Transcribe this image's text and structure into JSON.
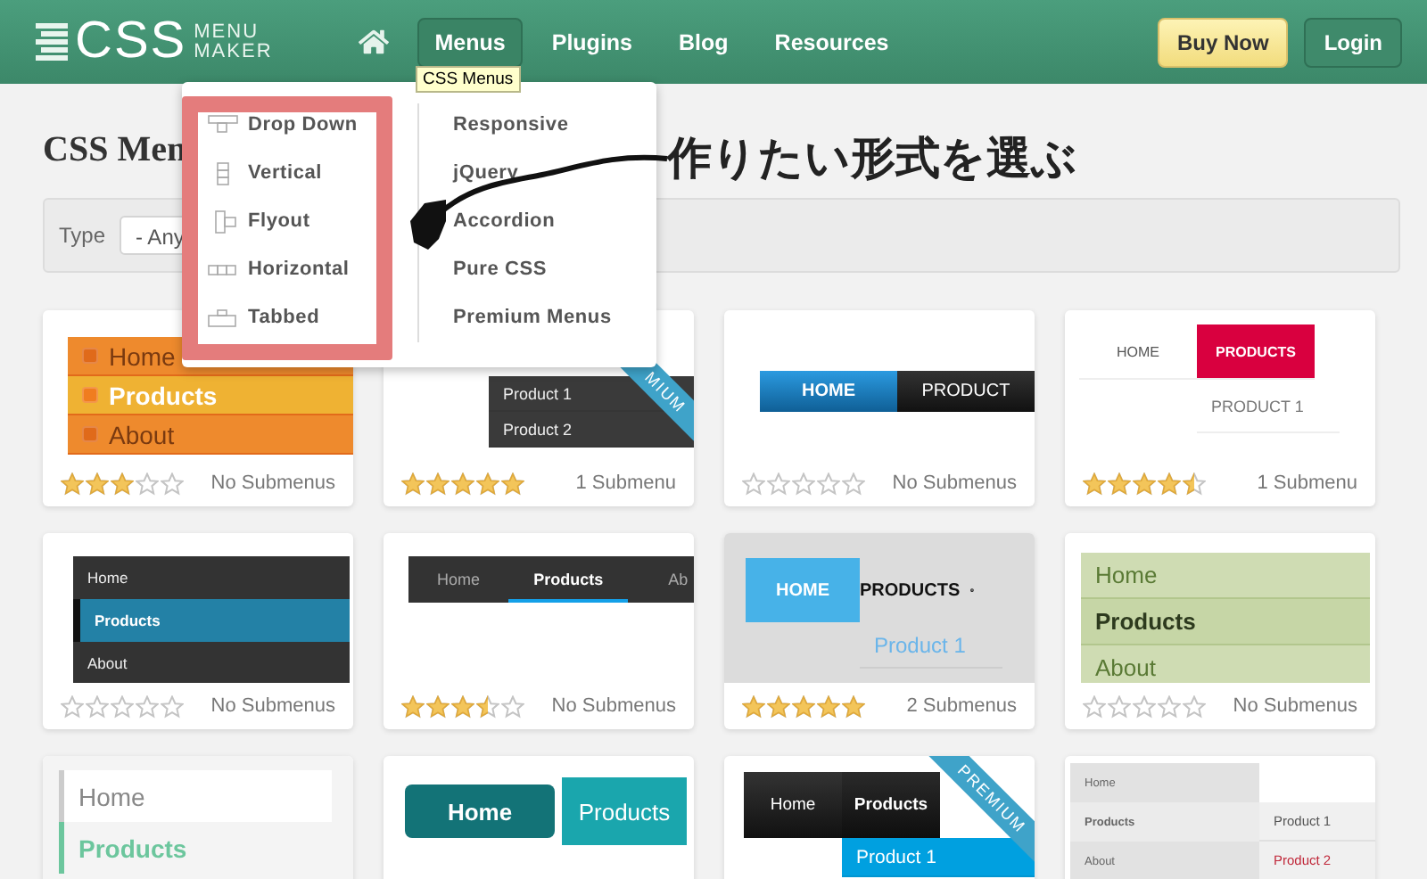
{
  "header": {
    "logo": {
      "main": "CSS",
      "top": "MENU",
      "bottom": "MAKER"
    },
    "nav": [
      {
        "label": "Menus",
        "selected": true
      },
      {
        "label": "Plugins",
        "selected": false
      },
      {
        "label": "Blog",
        "selected": false
      },
      {
        "label": "Resources",
        "selected": false
      }
    ],
    "buttons": [
      {
        "label": "Buy Now",
        "kind": "primary"
      },
      {
        "label": "Login",
        "kind": "secondary"
      }
    ]
  },
  "tooltip": "CSS Menus",
  "dropdown": {
    "types": [
      {
        "label": "Drop Down",
        "kind": "dropdown"
      },
      {
        "label": "Vertical",
        "kind": "vertical"
      },
      {
        "label": "Flyout",
        "kind": "flyout"
      },
      {
        "label": "Horizontal",
        "kind": "horizontal"
      },
      {
        "label": "Tabbed",
        "kind": "tabbed"
      }
    ],
    "features": [
      "Responsive",
      "jQuery",
      "Accordion",
      "Pure CSS",
      "Premium Menus"
    ]
  },
  "annotation": "作りたい形式を選ぶ",
  "page_title": "CSS Men",
  "filter": {
    "label": "Type",
    "value": "- Any"
  },
  "cards": [
    {
      "preview": {
        "kind": "orange",
        "items": [
          {
            "label": "Home",
            "selected": false
          },
          {
            "label": "Products",
            "selected": true
          },
          {
            "label": "About",
            "selected": false
          }
        ]
      },
      "stars": 3,
      "submenus": "No Submenus"
    },
    {
      "preview": {
        "kind": "dark-drop",
        "submenu": [
          {
            "label": "Product 1"
          },
          {
            "label": "Product 2"
          }
        ]
      },
      "ribbon": "MIUM",
      "stars": 5,
      "submenus": "1 Submenu"
    },
    {
      "preview": {
        "kind": "glossy",
        "items": [
          {
            "label": "HOME",
            "selected": true
          },
          {
            "label": "PRODUCT",
            "selected": false
          }
        ]
      },
      "stars": 0,
      "submenus": "No Submenus"
    },
    {
      "preview": {
        "kind": "flat-red",
        "items": [
          {
            "label": "HOME",
            "selected": false
          },
          {
            "label": "PRODUCTS",
            "selected": true,
            "submenu": [
              {
                "label": "PRODUCT 1"
              }
            ]
          }
        ]
      },
      "stars": 4.5,
      "submenus": "1 Submenu"
    },
    {
      "preview": {
        "kind": "dark-vertical",
        "items": [
          {
            "label": "Home",
            "selected": false
          },
          {
            "label": "Products",
            "selected": true
          },
          {
            "label": "About",
            "selected": false
          }
        ]
      },
      "stars": 0,
      "submenus": "No Submenus"
    },
    {
      "preview": {
        "kind": "dark-tabs",
        "items": [
          {
            "label": "Home",
            "selected": false
          },
          {
            "label": "Products",
            "selected": true
          },
          {
            "label": "Ab",
            "selected": false
          }
        ]
      },
      "stars": 3.5,
      "submenus": "No Submenus"
    },
    {
      "preview": {
        "kind": "blue-block",
        "items": [
          {
            "label": "HOME",
            "selected": true
          },
          {
            "label": "PRODUCTS",
            "selected": false,
            "submenu": [
              {
                "label": "Product 1"
              }
            ]
          }
        ]
      },
      "stars": 5,
      "submenus": "2 Submenus"
    },
    {
      "preview": {
        "kind": "green",
        "items": [
          {
            "label": "Home",
            "selected": false
          },
          {
            "label": "Products",
            "selected": true
          },
          {
            "label": "About",
            "selected": false
          }
        ]
      },
      "stars": 0,
      "submenus": "No Submenus"
    },
    {
      "preview": {
        "kind": "light-vertical",
        "items": [
          {
            "label": "Home",
            "selected": false
          },
          {
            "label": "Products",
            "selected": true
          }
        ]
      }
    },
    {
      "preview": {
        "kind": "teal",
        "items": [
          {
            "label": "Home",
            "selected": true
          },
          {
            "label": "Products",
            "selected": false
          }
        ]
      }
    },
    {
      "preview": {
        "kind": "black-glossy",
        "items": [
          {
            "label": "Home",
            "selected": false
          },
          {
            "label": "Products",
            "selected": true,
            "submenu": [
              {
                "label": "Product 1"
              }
            ]
          }
        ]
      },
      "ribbon": "PREMIUM"
    },
    {
      "preview": {
        "kind": "gray-flyout",
        "items": [
          {
            "label": "Home",
            "selected": false
          },
          {
            "label": "Products",
            "selected": true,
            "submenu": [
              {
                "label": "Product 1",
                "selected": false
              },
              {
                "label": "Product 2",
                "selected": true
              }
            ]
          },
          {
            "label": "About",
            "selected": false
          }
        ]
      }
    }
  ]
}
